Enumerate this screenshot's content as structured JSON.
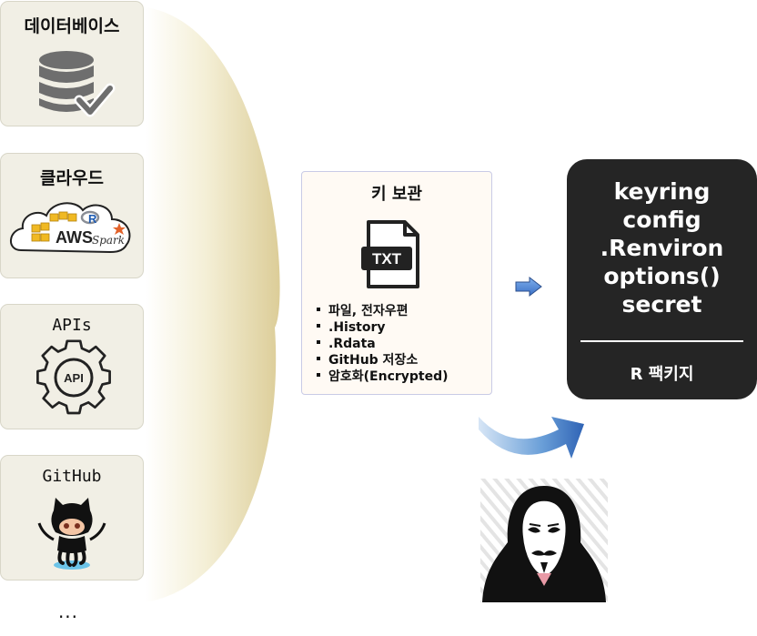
{
  "sources": [
    {
      "title": "데이터베이스",
      "icon": "database-check-icon"
    },
    {
      "title": "클라우드",
      "icon": "cloud-aws-spark-icon",
      "cloud_text": "AWS",
      "spark_text": "Spark",
      "r_text": "R"
    },
    {
      "title": "APIs",
      "icon": "api-gear-icon",
      "badge_text": "API"
    },
    {
      "title": "GitHub",
      "icon": "octocat-icon"
    }
  ],
  "more_label": "...",
  "storage": {
    "title": "키 보관",
    "file_icon_text": "TXT",
    "items": [
      "파일, 전자우편",
      ".History",
      ".Rdata",
      "GitHub 저장소",
      "암호화(Encrypted)"
    ]
  },
  "package": {
    "names": [
      "keyring",
      "config",
      ".Renviron",
      "options()",
      "secret"
    ],
    "footer": "R 팩키지"
  },
  "colors": {
    "card_bg": "#f1efe5",
    "package_bg": "#252525",
    "arrow_blue": "#4a7fd4",
    "curtain": "#e9ddb2"
  },
  "icons": {
    "arrow": "right-arrow-icon",
    "curved_arrow": "curved-arrow-icon",
    "hacker": "anonymous-hacker-icon"
  }
}
